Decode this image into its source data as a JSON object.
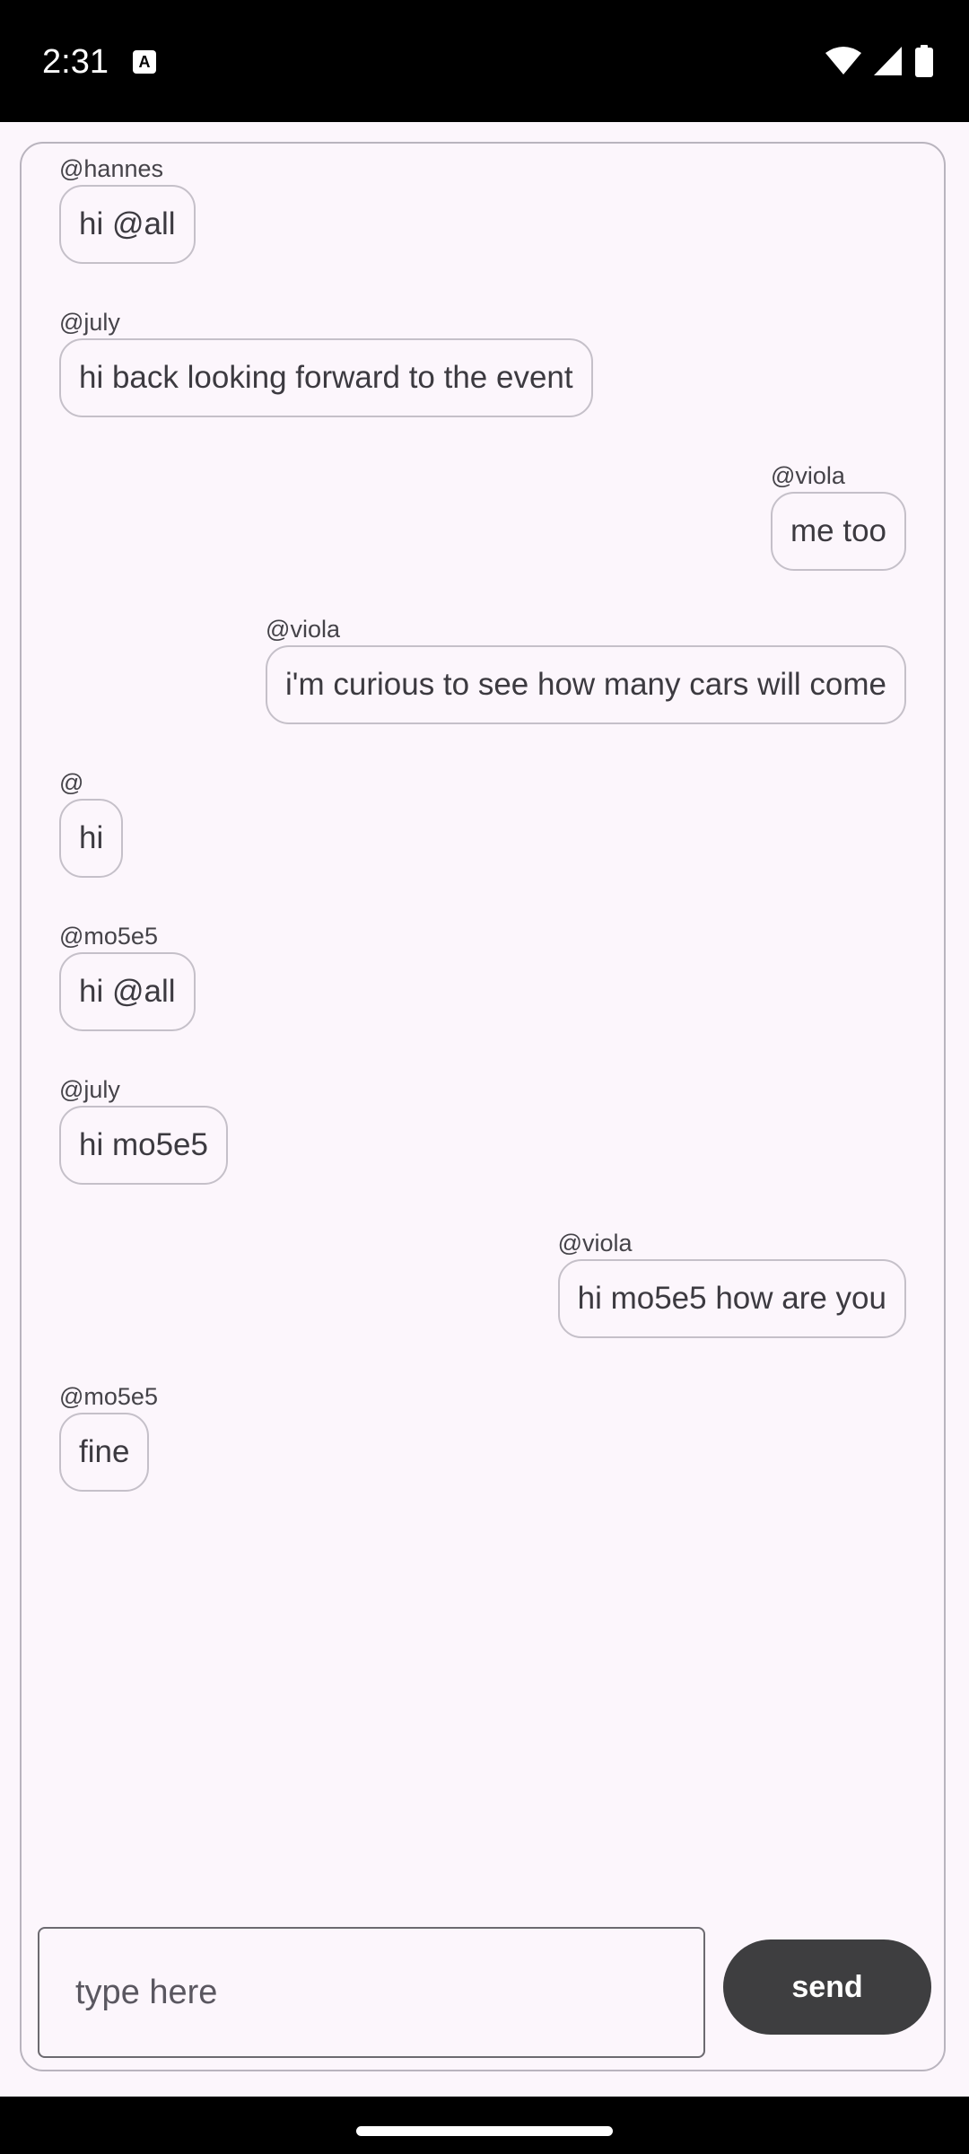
{
  "status_bar": {
    "time": "2:31",
    "notification_icon": "A",
    "icons": [
      "wifi-icon",
      "signal-icon",
      "battery-icon"
    ]
  },
  "chat": {
    "messages": [
      {
        "sender": "@hannes",
        "text": "hi @all",
        "align": "left"
      },
      {
        "sender": "@july",
        "text": "hi back looking forward to the event",
        "align": "left"
      },
      {
        "sender": "@viola",
        "text": "me too",
        "align": "right"
      },
      {
        "sender": "@viola",
        "text": "i'm curious to see how many cars will come",
        "align": "right"
      },
      {
        "sender": "@",
        "text": "hi",
        "align": "left"
      },
      {
        "sender": "@mo5e5",
        "text": "hi @all",
        "align": "left"
      },
      {
        "sender": "@july",
        "text": "hi mo5e5",
        "align": "left"
      },
      {
        "sender": "@viola",
        "text": "hi mo5e5 how are you",
        "align": "right"
      },
      {
        "sender": "@mo5e5",
        "text": "fine",
        "align": "left"
      }
    ]
  },
  "composer": {
    "placeholder": "type here",
    "value": "",
    "send_label": "send"
  },
  "colors": {
    "background": "#fcf6fc",
    "border": "#b9b4be",
    "send_button": "#3e3e40"
  }
}
